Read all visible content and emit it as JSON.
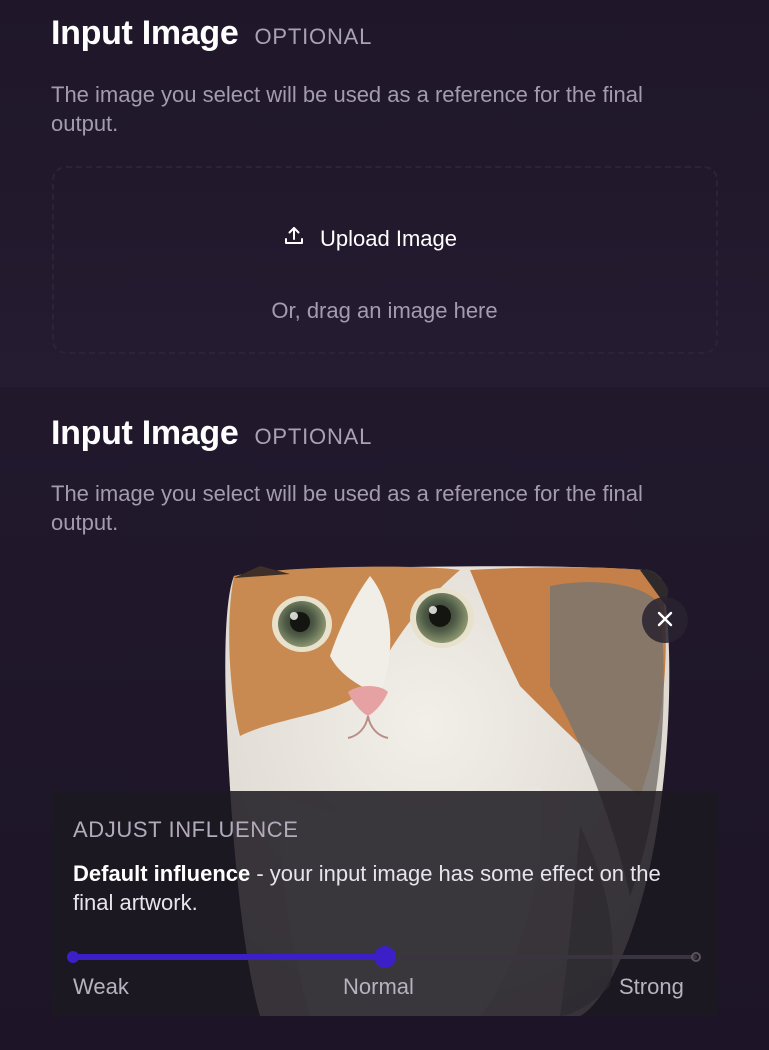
{
  "sections": [
    {
      "title": "Input Image",
      "optional_label": "OPTIONAL",
      "description": "The image you select will be used as a reference for the final output."
    },
    {
      "title": "Input Image",
      "optional_label": "OPTIONAL",
      "description": "The image you select will be used as a reference for the final output."
    }
  ],
  "upload": {
    "button_label": "Upload Image",
    "button_icon": "upload-icon",
    "drag_hint": "Or, drag an image here"
  },
  "preview": {
    "image_icon": "cat-photo",
    "remove_icon": "close-icon"
  },
  "influence": {
    "title": "ADJUST INFLUENCE",
    "description_strong": "Default influence",
    "description_rest": " - your input image has some effect on the final artwork.",
    "value_fraction": 0.5,
    "labels": {
      "weak": "Weak",
      "normal": "Normal",
      "strong": "Strong"
    }
  },
  "colors": {
    "accent": "#3c1fc7",
    "background": "#1c1426",
    "muted_text": "#a39bae"
  }
}
